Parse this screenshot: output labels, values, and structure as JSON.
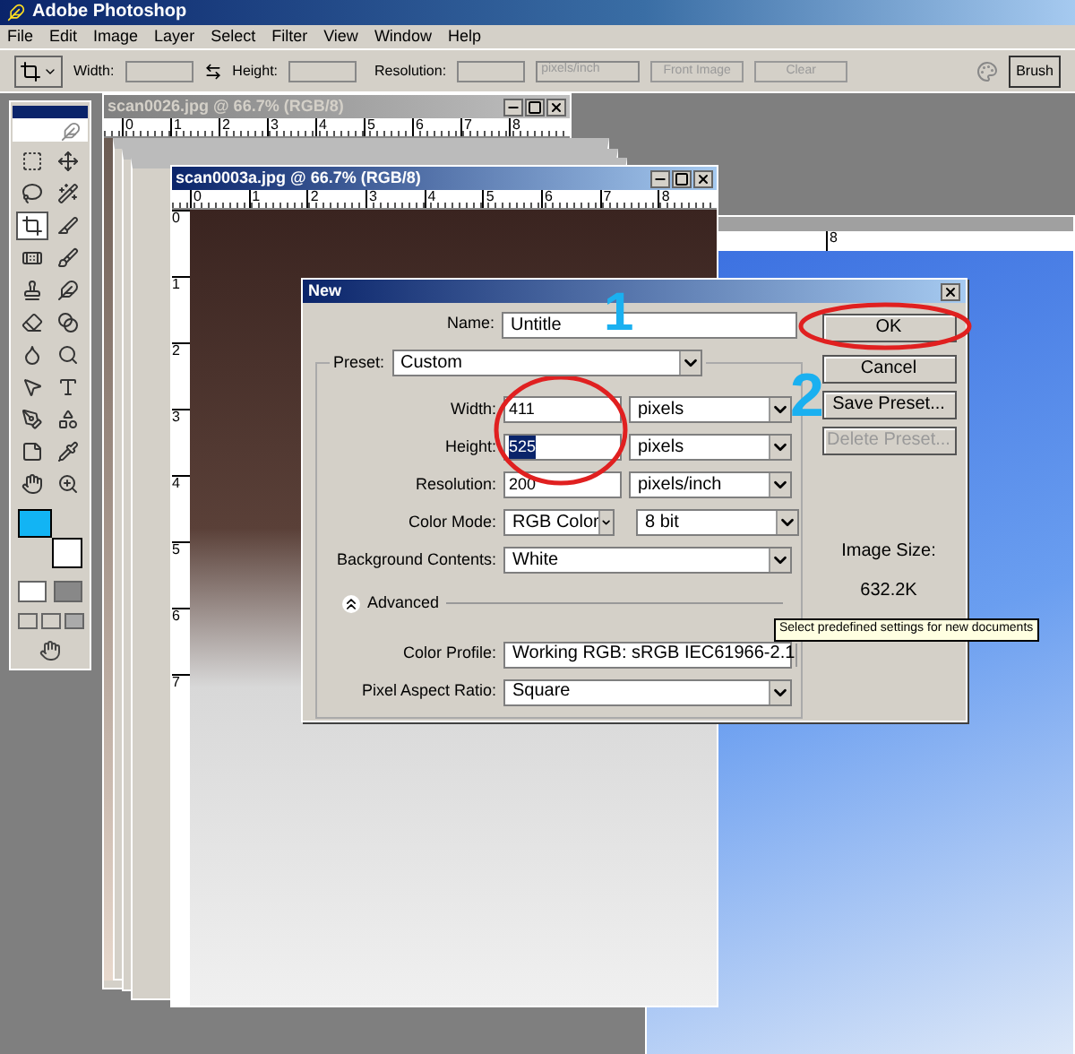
{
  "window": {
    "title": "Adobe Photoshop"
  },
  "menu": [
    "File",
    "Edit",
    "Image",
    "Layer",
    "Select",
    "Filter",
    "View",
    "Window",
    "Help"
  ],
  "options_bar": {
    "width_label": "Width:",
    "height_label": "Height:",
    "resolution_label": "Resolution:",
    "units": {
      "value": "pixels/inch",
      "disabled": true
    },
    "buttons": [
      {
        "label": "Front Image",
        "disabled": true
      },
      {
        "label": "Clear",
        "disabled": true
      }
    ],
    "palette_tab": "Brush"
  },
  "toolbox": {
    "tools": [
      {
        "selected": false
      },
      {
        "selected": false
      },
      {
        "selected": false
      },
      {
        "selected": false
      },
      {
        "selected": true
      },
      {
        "selected": false
      },
      {
        "selected": false
      },
      {
        "selected": false
      },
      {
        "selected": false
      },
      {
        "selected": false
      },
      {
        "selected": false
      },
      {
        "selected": false
      },
      {
        "selected": false
      },
      {
        "selected": false
      },
      {
        "selected": false
      },
      {
        "selected": false
      },
      {
        "selected": false
      },
      {
        "selected": false
      },
      {
        "selected": false
      },
      {
        "selected": false
      },
      {
        "selected": false
      },
      {
        "selected": false
      }
    ]
  },
  "documents": [
    {
      "title": "scan0026.jpg @ 66.7% (RGB/8)",
      "active": false,
      "ruler": [
        "0",
        "1",
        "2",
        "3",
        "4",
        "5",
        "6",
        "7",
        "8"
      ]
    },
    {
      "title": "scan0003a.jpg @ 66.7% (RGB/8)",
      "active": true,
      "ruler": [
        "0",
        "1",
        "2",
        "3",
        "4",
        "5",
        "6",
        "7",
        "8"
      ],
      "vertical_ruler": [
        "0",
        "1",
        "2",
        "3",
        "4",
        "5",
        "6",
        "7"
      ]
    }
  ],
  "side_document": {
    "ruler": [
      "8"
    ]
  },
  "dialog": {
    "title": "New",
    "name_label": "Name:",
    "name_value": "Untitle",
    "preset_label": "Preset:",
    "preset_value": "Custom",
    "rows": [
      {
        "label": "Width:",
        "value": "411",
        "unit": "pixels",
        "selected_text": false
      },
      {
        "label": "Height:",
        "value": "525",
        "unit": "pixels",
        "selected_text": true
      },
      {
        "label": "Resolution:",
        "value": "200",
        "unit": "pixels/inch",
        "selected_text": false
      }
    ],
    "color_mode_label": "Color Mode:",
    "color_mode": "RGB Color",
    "bit_depth": "8 bit",
    "background_label": "Background Contents:",
    "background_value": "White",
    "advanced": {
      "label": "Advanced",
      "expanded": true
    },
    "color_profile_label": "Color Profile:",
    "color_profile": "Working RGB:  sRGB IEC61966-2.1",
    "aspect_label": "Pixel Aspect Ratio:",
    "aspect_value": "Square",
    "buttons": [
      {
        "label": "OK",
        "disabled": false
      },
      {
        "label": "Cancel",
        "disabled": false
      },
      {
        "label": "Save Preset...",
        "disabled": false
      },
      {
        "label": "Delete Preset...",
        "disabled": true
      }
    ],
    "image_size_label": "Image Size:",
    "image_size": "632.2K"
  },
  "tooltip": "Select predefined settings for new documents",
  "annotations": [
    "1",
    "2"
  ]
}
